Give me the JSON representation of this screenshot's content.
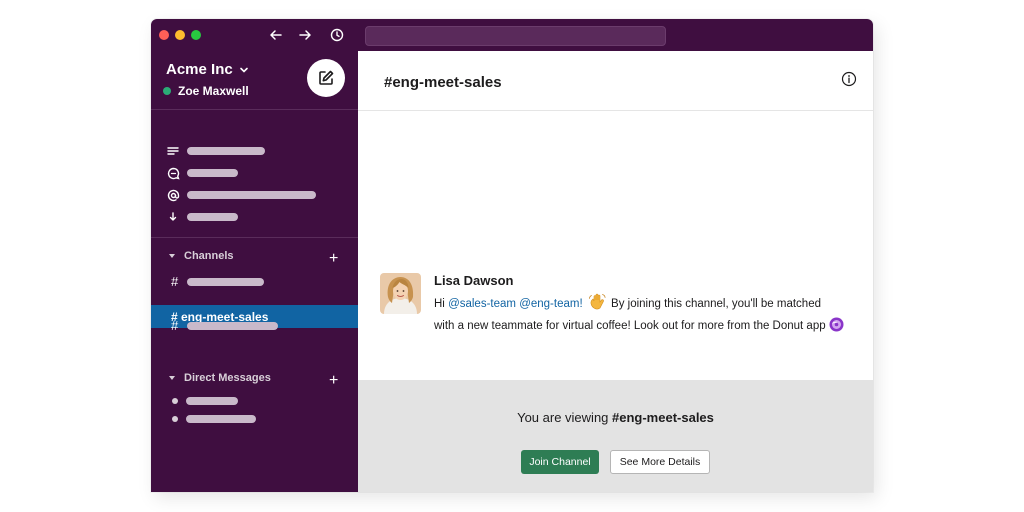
{
  "window": {
    "traffic_lights": [
      "#ff5f57",
      "#febc2e",
      "#28c840"
    ],
    "nav": {
      "back_icon": "arrow-left-icon",
      "forward_icon": "arrow-right-icon",
      "history_icon": "clock-icon"
    }
  },
  "workspace": {
    "name": "Acme Inc",
    "user": "Zoe Maxwell",
    "status_color": "#2bac76"
  },
  "sidebar": {
    "top_items": [
      {
        "icon": "threads-icon"
      },
      {
        "icon": "dm-bubble-icon"
      },
      {
        "icon": "mentions-icon"
      },
      {
        "icon": "more-icon"
      }
    ],
    "channels_label": "Channels",
    "active_channel": "# eng-meet-sales",
    "direct_messages_label": "Direct Messages"
  },
  "channel": {
    "title": "#eng-meet-sales"
  },
  "message": {
    "author": "Lisa Dawson",
    "greeting": "Hi ",
    "mention_1": "@sales-team",
    "mention_2": "@eng-team!",
    "body": " By joining this channel, you'll be matched with a new teammate for virtual coffee! Look out for more from the Donut app"
  },
  "footer": {
    "viewing_prefix": "You are viewing ",
    "viewing_channel": "#eng-meet-sales",
    "join_label": "Join Channel",
    "details_label": "See More Details"
  },
  "colors": {
    "sidebar": "#3f0e40",
    "active": "#1164a3",
    "join": "#2e7d54",
    "mention": "#1264a3"
  }
}
